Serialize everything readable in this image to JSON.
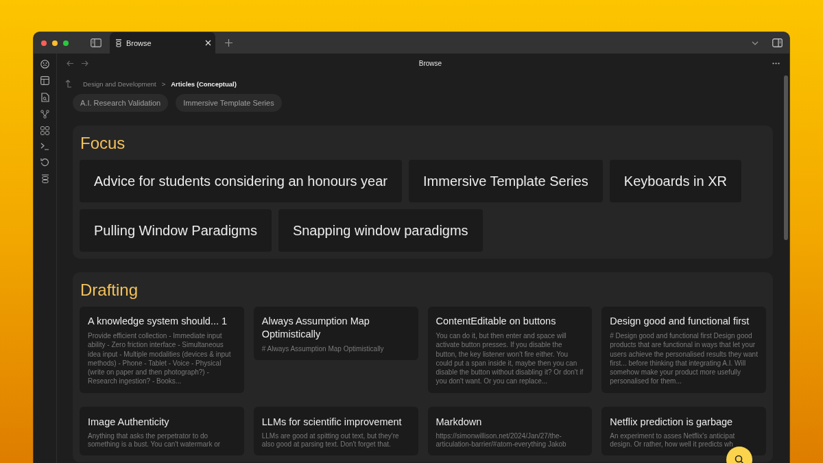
{
  "window": {
    "tab": {
      "title": "Browse",
      "selected": true
    },
    "header_title": "Browse"
  },
  "breadcrumb": {
    "items": [
      {
        "label": "Design and Development",
        "kind": "link",
        "current": false
      },
      {
        "label": ">",
        "kind": "separator"
      },
      {
        "label": "Articles (Conceptual)",
        "kind": "link",
        "current": true
      }
    ]
  },
  "chips": [
    "A.I. Research Validation",
    "Immersive Template Series"
  ],
  "sections": [
    {
      "title": "Focus",
      "kind": "large",
      "items": [
        {
          "title": "Advice for students considering an honours year"
        },
        {
          "title": "Immersive Template Series"
        },
        {
          "title": "Keyboards in XR"
        },
        {
          "title": "Pulling Window Paradigms"
        },
        {
          "title": "Snapping window paradigms"
        }
      ]
    },
    {
      "title": "Drafting",
      "kind": "cards",
      "items": [
        {
          "title": "A knowledge system should... 1",
          "body": "Provide efficient collection - Immediate input ability - Zero friction interface - Simultaneous idea input - Multiple modalities (devices & input methods) - Phone - Tablet - Voice - Physical (write on paper and then photograph?) - Research ingestion? - Books..."
        },
        {
          "title": "Always Assumption Map Optimistically",
          "body": "# Always Assumption Map Optimistically"
        },
        {
          "title": "ContentEditable on buttons",
          "body": "You can do it, but then enter and space will activate button presses. If you disable the button, the key listener won't fire either. You could put a span inside it, maybe then you can disable the button without disabling it? Or don't if you don't want. Or you can replace..."
        },
        {
          "title": "Design good and functional first",
          "body": "# Design good and functional first Design good products that are functional in ways that let your users achieve the personalised results they want first... before thinking that integrating A.I. Will somehow make your product more usefully personalised for them..."
        },
        {
          "title": "Image Authenticity",
          "body": "Anything that asks the perpetrator to do something is a bust. You can't watermark or"
        },
        {
          "title": "LLMs for scientific improvement",
          "body": "LLMs are good at spitting out text, but they're also good at parsing text. Don't forget that."
        },
        {
          "title": "Markdown",
          "body": "https://simonwillison.net/2024/Jan/27/the-articulation-barrier/#atom-everything Jakob"
        },
        {
          "title": "Netflix prediction is garbage",
          "body": "An experiment to asses Netflix's anticipat design. Or rather, how well it predicts wh"
        }
      ]
    }
  ]
}
